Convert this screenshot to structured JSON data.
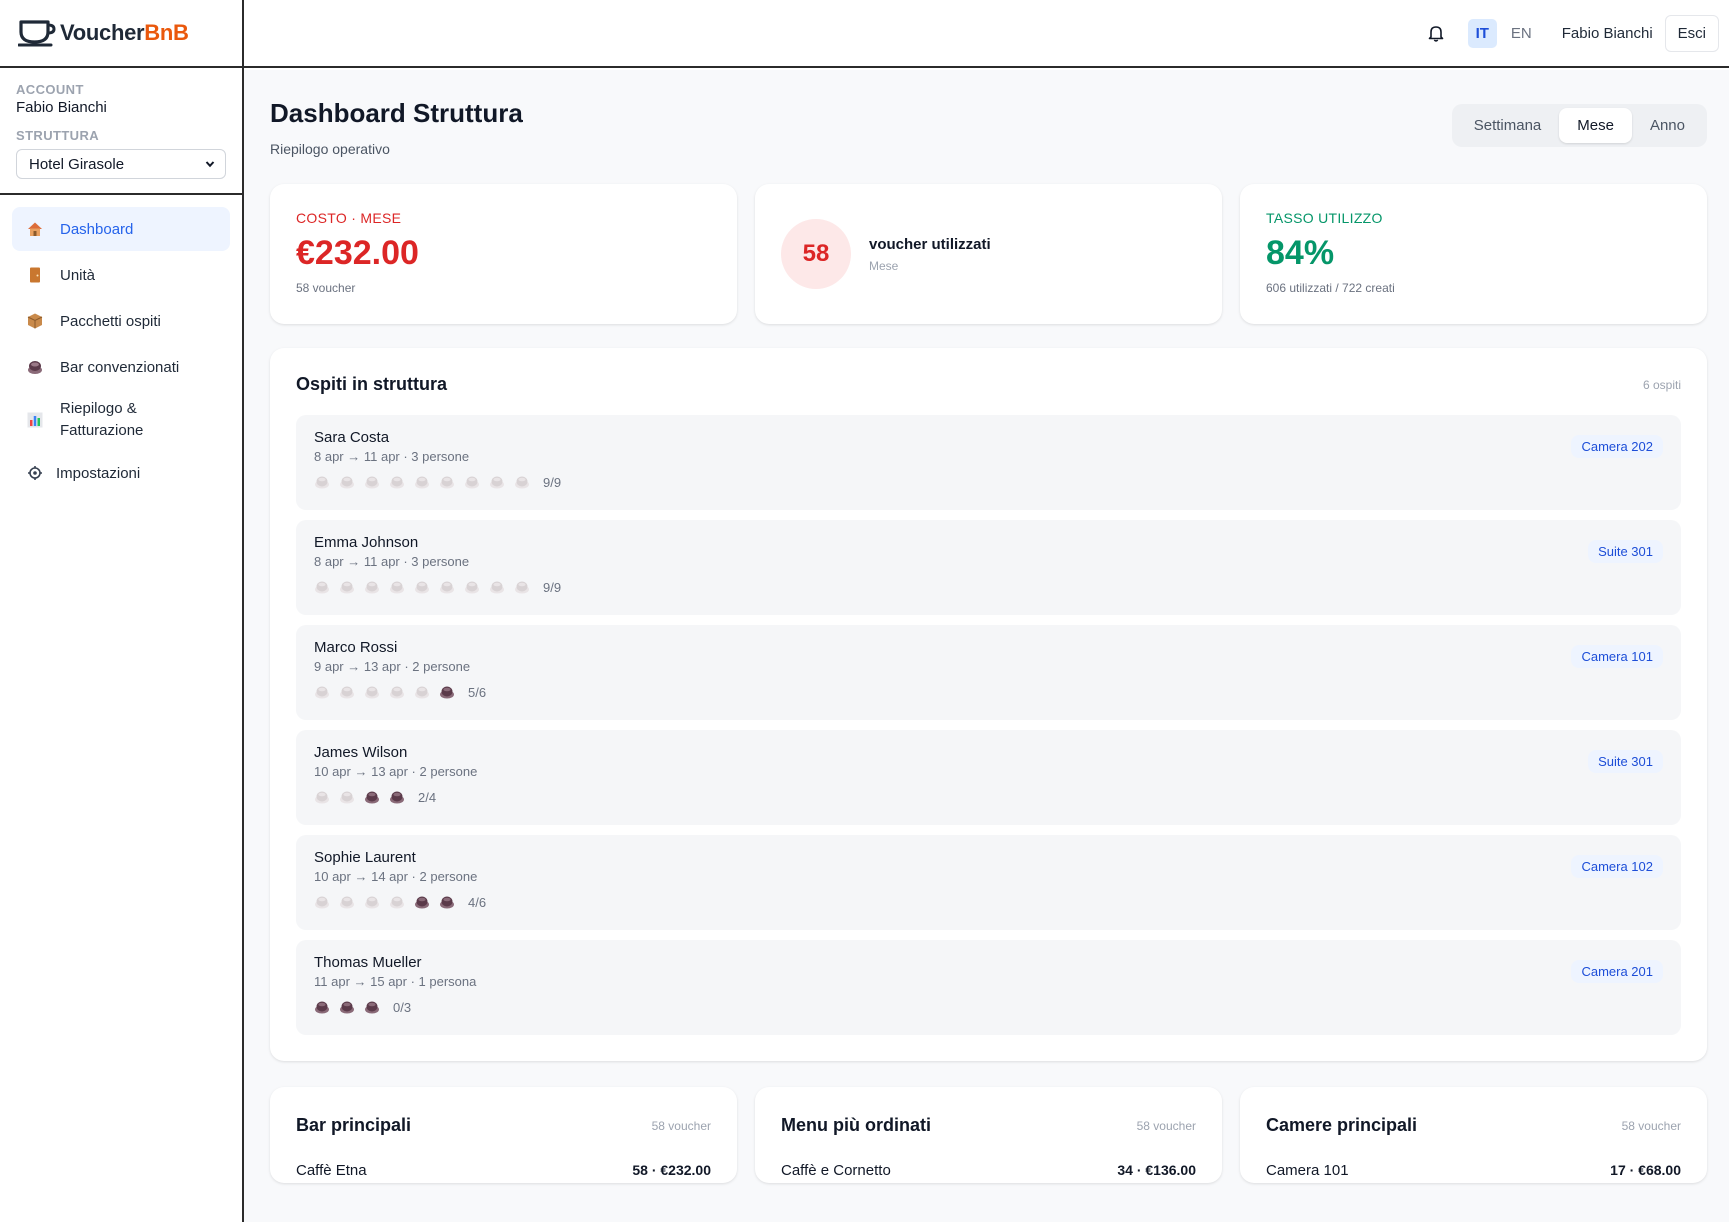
{
  "brand": {
    "name_main": "Voucher",
    "name_accent": "BnB"
  },
  "sidebar": {
    "account_label": "ACCOUNT",
    "account_name": "Fabio Bianchi",
    "structure_label": "STRUTTURA",
    "structure_value": "Hotel Girasole",
    "items": [
      {
        "label": "Dashboard",
        "icon": "house-icon"
      },
      {
        "label": "Unità",
        "icon": "door-icon"
      },
      {
        "label": "Pacchetti ospiti",
        "icon": "package-icon"
      },
      {
        "label": "Bar convenzionati",
        "icon": "coffee-icon"
      },
      {
        "label": "Riepilogo & Fatturazione",
        "icon": "bar-chart-icon"
      },
      {
        "label": "Impostazioni",
        "icon": "gear-icon"
      }
    ]
  },
  "topbar": {
    "lang_it": "IT",
    "lang_en": "EN",
    "user": "Fabio Bianchi",
    "logout": "Esci"
  },
  "header": {
    "title": "Dashboard Struttura",
    "subtitle": "Riepilogo operativo",
    "periods": [
      "Settimana",
      "Mese",
      "Anno"
    ],
    "active_period": "Mese"
  },
  "stats": {
    "cost": {
      "label": "COSTO · MESE",
      "value": "€232.00",
      "foot": "58 voucher"
    },
    "used": {
      "value": "58",
      "title": "voucher utilizzati",
      "sub": "Mese"
    },
    "rate": {
      "label": "TASSO UTILIZZO",
      "value": "84%",
      "foot": "606 utilizzati / 722 creati"
    }
  },
  "guests": {
    "title": "Ospiti in struttura",
    "count": "6 ospiti",
    "list": [
      {
        "name": "Sara Costa",
        "dates": "8 apr → 11 apr · 3 persone",
        "room": "Camera 202",
        "used": 9,
        "total": 9,
        "count": "9/9"
      },
      {
        "name": "Emma Johnson",
        "dates": "8 apr → 11 apr · 3 persone",
        "room": "Suite 301",
        "used": 9,
        "total": 9,
        "count": "9/9"
      },
      {
        "name": "Marco Rossi",
        "dates": "9 apr → 13 apr · 2 persone",
        "room": "Camera 101",
        "used": 5,
        "total": 6,
        "count": "5/6"
      },
      {
        "name": "James Wilson",
        "dates": "10 apr → 13 apr · 2 persone",
        "room": "Suite 301",
        "used": 2,
        "total": 4,
        "count": "2/4"
      },
      {
        "name": "Sophie Laurent",
        "dates": "10 apr → 14 apr · 2 persone",
        "room": "Camera 102",
        "used": 4,
        "total": 6,
        "count": "4/6"
      },
      {
        "name": "Thomas Mueller",
        "dates": "11 apr → 15 apr · 1 persona",
        "room": "Camera 201",
        "used": 0,
        "total": 3,
        "count": "0/3"
      }
    ]
  },
  "bottom": [
    {
      "title": "Bar principali",
      "count": "58 voucher",
      "row_label": "Caffè Etna",
      "row_value": "58 · €232.00"
    },
    {
      "title": "Menu più ordinati",
      "count": "58 voucher",
      "row_label": "Caffè e Cornetto",
      "row_value": "34 · €136.00"
    },
    {
      "title": "Camere principali",
      "count": "58 voucher",
      "row_label": "Camera 101",
      "row_value": "17 · €68.00"
    }
  ],
  "colors": {
    "accent": "#2563eb",
    "brand_accent": "#ea580c",
    "cost_red": "#dc2626",
    "rate_green": "#059669",
    "cup_used": "#d8d2d4",
    "cup_available": "#5b3a4a"
  }
}
